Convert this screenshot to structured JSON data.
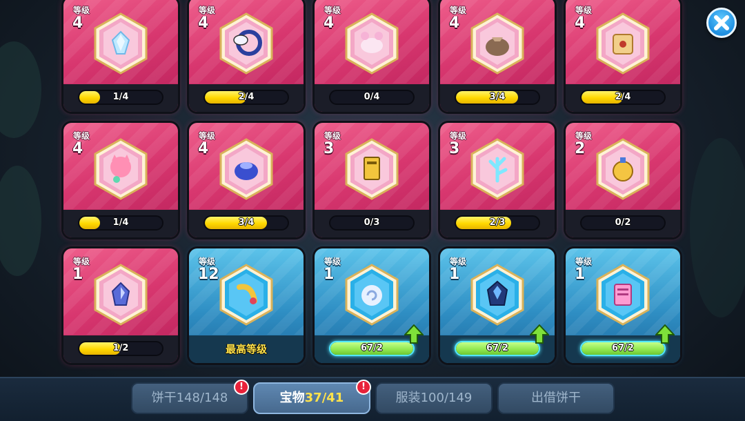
{
  "level_label": "等级",
  "max_level_text": "最高等级",
  "colors": {
    "pink_card": "#d8376f",
    "blue_card": "#2f8fc4",
    "progress_yellow": "#ffd800",
    "progress_green": "#8fe64e"
  },
  "treasures": [
    {
      "level": "4",
      "progress": "1/4",
      "fill": 0.25,
      "rarity": "epic",
      "icon": "crystal-shard-icon"
    },
    {
      "level": "4",
      "progress": "2/4",
      "fill": 0.5,
      "rarity": "epic",
      "icon": "serpent-horn-icon"
    },
    {
      "level": "4",
      "progress": "0/4",
      "fill": 0,
      "rarity": "epic",
      "icon": "flower-bunny-icon"
    },
    {
      "level": "4",
      "progress": "3/4",
      "fill": 0.75,
      "rarity": "epic",
      "icon": "sack-icon"
    },
    {
      "level": "4",
      "progress": "2/4",
      "fill": 0.5,
      "rarity": "epic",
      "icon": "scroll-map-icon"
    },
    {
      "level": "4",
      "progress": "1/4",
      "fill": 0.25,
      "rarity": "epic",
      "icon": "cat-balloon-icon"
    },
    {
      "level": "4",
      "progress": "3/4",
      "fill": 0.75,
      "rarity": "epic",
      "icon": "blue-pouch-icon"
    },
    {
      "level": "3",
      "progress": "0/3",
      "fill": 0,
      "rarity": "epic",
      "icon": "golden-tablet-icon"
    },
    {
      "level": "3",
      "progress": "2/3",
      "fill": 0.67,
      "rarity": "epic",
      "icon": "ice-branch-icon"
    },
    {
      "level": "2",
      "progress": "0/2",
      "fill": 0,
      "rarity": "epic",
      "icon": "potion-bottle-icon"
    },
    {
      "level": "1",
      "progress": "1/2",
      "fill": 0.5,
      "rarity": "epic",
      "icon": "gem-stone-icon"
    },
    {
      "level": "12",
      "progress": "",
      "fill": 1,
      "rarity": "rare",
      "max": true,
      "icon": "golden-horn-icon"
    },
    {
      "level": "1",
      "progress": "67/2",
      "fill": 1,
      "rarity": "rare",
      "upgrade": true,
      "icon": "spiral-shell-icon"
    },
    {
      "level": "1",
      "progress": "67/2",
      "fill": 1,
      "rarity": "rare",
      "upgrade": true,
      "icon": "dark-crystal-icon"
    },
    {
      "level": "1",
      "progress": "67/2",
      "fill": 1,
      "rarity": "rare",
      "upgrade": true,
      "icon": "pink-scroll-icon"
    }
  ],
  "tabs": [
    {
      "label": "饼干",
      "count": "148/148",
      "badge": "!",
      "active": false
    },
    {
      "label": "宝物",
      "count": "37/41",
      "badge": "!",
      "active": true
    },
    {
      "label": "服装",
      "count": "100/149",
      "badge": "",
      "active": false
    },
    {
      "label": "出借饼干",
      "count": "",
      "badge": "",
      "active": false
    }
  ],
  "close_icon": "close-icon"
}
